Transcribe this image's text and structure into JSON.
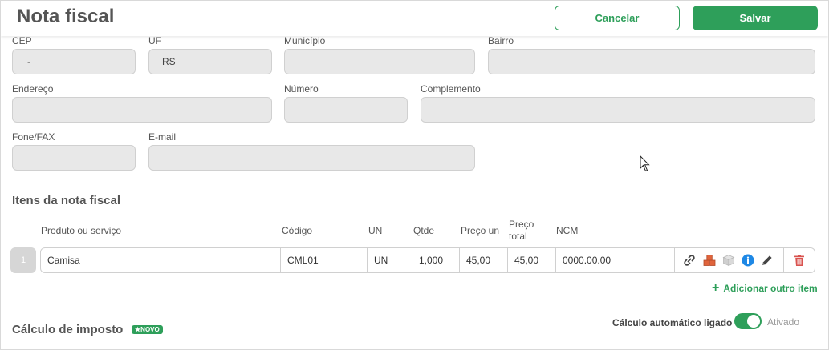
{
  "header": {
    "title": "Nota fiscal",
    "cancel_label": "Cancelar",
    "save_label": "Salvar"
  },
  "address": {
    "cep": {
      "label": "CEP",
      "value": "-"
    },
    "uf": {
      "label": "UF",
      "value": "RS"
    },
    "municipio": {
      "label": "Município",
      "value": ""
    },
    "bairro": {
      "label": "Bairro",
      "value": ""
    },
    "endereco": {
      "label": "Endereço",
      "value": ""
    },
    "numero": {
      "label": "Número",
      "value": ""
    },
    "complemento": {
      "label": "Complemento",
      "value": ""
    },
    "fone": {
      "label": "Fone/FAX",
      "value": ""
    },
    "email": {
      "label": "E-mail",
      "value": ""
    }
  },
  "items": {
    "title": "Itens da nota fiscal",
    "columns": {
      "produto": "Produto ou serviço",
      "codigo": "Código",
      "un": "UN",
      "qtde": "Qtde",
      "preco_un": "Preço un",
      "preco_total_1": "Preço",
      "preco_total_2": "total",
      "ncm": "NCM"
    },
    "rows": [
      {
        "num": "1",
        "produto": "Camisa",
        "codigo": "CML01",
        "un": "UN",
        "qtde": "1,000",
        "preco_un": "45,00",
        "preco_total": "45,00",
        "ncm": "0000.00.00"
      }
    ],
    "add_label": "Adicionar outro item"
  },
  "tax": {
    "title": "Cálculo de imposto",
    "badge": "NOVO",
    "auto_label": "Cálculo automático ligado",
    "auto_state": "Ativado",
    "auto_on": true
  },
  "colors": {
    "accent": "#2e9f5a",
    "field_bg": "#e8e8e8",
    "delete": "#d9534f",
    "info": "#1e88e5",
    "boxes": "#e0643c"
  },
  "icons": [
    "link-icon",
    "boxes-icon",
    "package-icon",
    "info-icon",
    "pencil-icon",
    "trash-icon",
    "plus-icon",
    "star-icon",
    "mouse-pointer-icon"
  ]
}
